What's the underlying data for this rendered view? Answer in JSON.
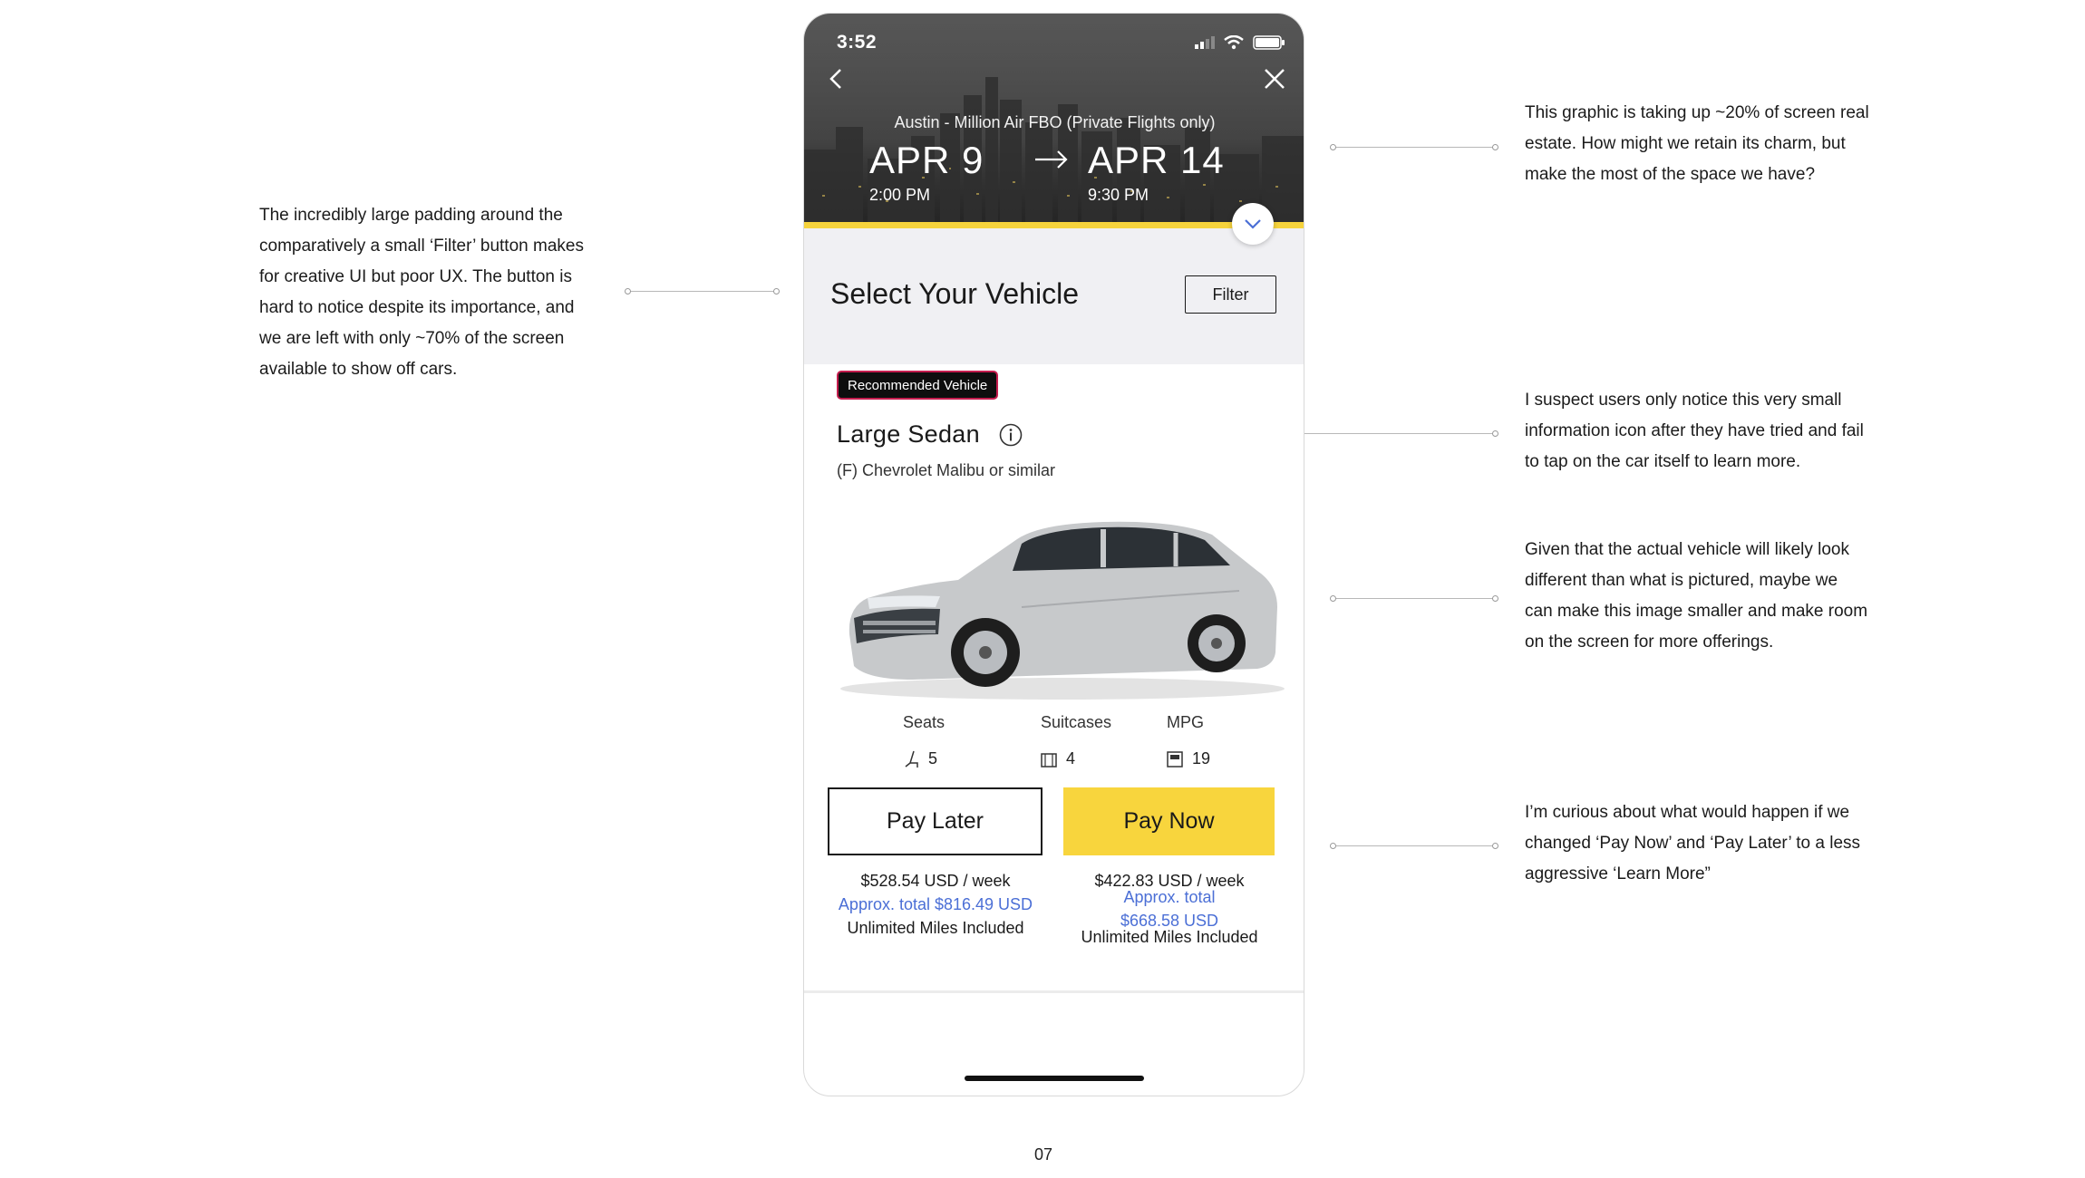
{
  "annotations": {
    "filter_padding": [
      "The incredibly large padding around the",
      "comparatively a small ‘Filter’ button makes",
      "for creative UI but poor UX. The button is",
      "hard to notice despite its importance, and",
      "we are left with only ~70% of the screen",
      "available to show off cars."
    ],
    "graphic_space": [
      "This graphic is taking up ~20% of screen real",
      "estate. How might we retain its charm, but",
      "make the most of the space we have?"
    ],
    "info_icon": [
      "I suspect users only notice this very small",
      "information icon after they have tried and fail",
      "to tap on the car itself to learn more."
    ],
    "vehicle_image": [
      "Given that the actual vehicle will likely look",
      "different than what is pictured, maybe we",
      "can make this image smaller and make room",
      "on the screen for more offerings."
    ],
    "pay_buttons": [
      "I’m curious about what would happen if we",
      "changed ‘Pay Now’ and ‘Pay Later’ to a less",
      "aggressive ‘Learn More”"
    ]
  },
  "page_number": "07",
  "phone": {
    "status": {
      "time": "3:52"
    },
    "location": "Austin - Million Air FBO (Private Flights only)",
    "pickup": {
      "date": "APR 9",
      "time": "2:00 PM"
    },
    "dropoff": {
      "date": "APR 14",
      "time": "9:30 PM"
    },
    "select_title": "Select Your Vehicle",
    "filter_label": "Filter",
    "badge": "Recommended Vehicle",
    "vehicle_class": "Large Sedan",
    "vehicle_model": "(F) Chevrolet Malibu or similar",
    "specs": {
      "seats_label": "Seats",
      "seats_value": "5",
      "suitcases_label": "Suitcases",
      "suitcases_value": "4",
      "mpg_label": "MPG",
      "mpg_value": "19"
    },
    "pay_later": {
      "label": "Pay Later",
      "price": "$528.54 USD / week",
      "approx": "Approx. total $816.49 USD",
      "miles": "Unlimited Miles Included"
    },
    "pay_now": {
      "label": "Pay Now",
      "price": "$422.83 USD / week",
      "approx_line1": "Approx. total",
      "approx_line2": "$668.58 USD",
      "miles": "Unlimited Miles Included"
    }
  },
  "colors": {
    "accent_yellow": "#f8d53d",
    "link_blue": "#4b6fd6",
    "badge_border": "#c51d4e"
  }
}
